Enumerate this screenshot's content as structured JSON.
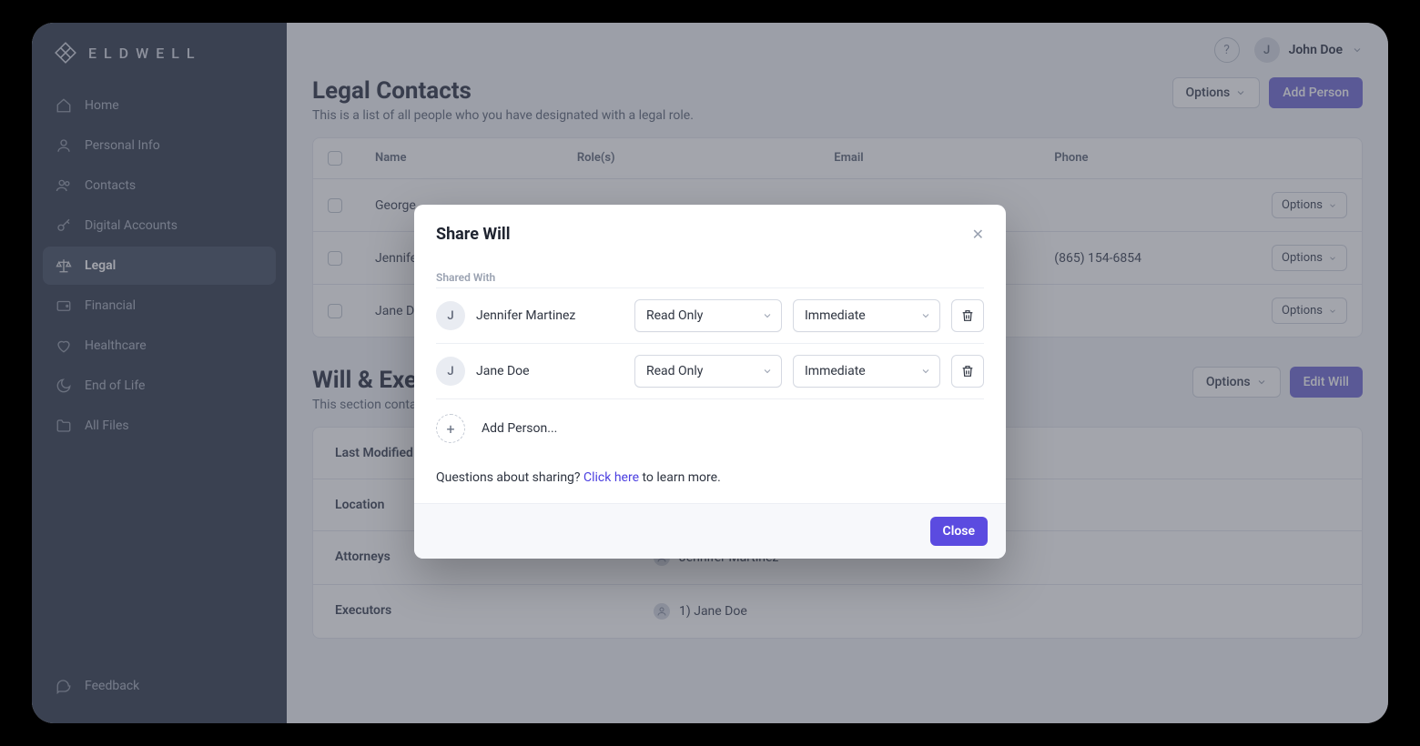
{
  "brand": "ELDWELL",
  "user": {
    "initial": "J",
    "name": "John Doe"
  },
  "nav": [
    {
      "label": "Home"
    },
    {
      "label": "Personal Info"
    },
    {
      "label": "Contacts"
    },
    {
      "label": "Digital Accounts"
    },
    {
      "label": "Legal",
      "active": true
    },
    {
      "label": "Financial"
    },
    {
      "label": "Healthcare"
    },
    {
      "label": "End of Life"
    },
    {
      "label": "All Files"
    }
  ],
  "feedback_label": "Feedback",
  "sections": {
    "contacts": {
      "title": "Legal Contacts",
      "subtitle": "This is a list of all people who you have designated with a legal role.",
      "options_label": "Options",
      "add_label": "Add Person",
      "columns": {
        "name": "Name",
        "roles": "Role(s)",
        "email": "Email",
        "phone": "Phone"
      },
      "rows": [
        {
          "name": "George",
          "roles": "",
          "email": "",
          "phone": "",
          "opt": "Options"
        },
        {
          "name": "Jennifer",
          "roles": "",
          "email": "",
          "phone": "(865) 154-6854",
          "opt": "Options"
        },
        {
          "name": "Jane Doe",
          "roles": "",
          "email": "",
          "phone": "",
          "opt": "Options"
        }
      ]
    },
    "will": {
      "title": "Will & Executors",
      "subtitle": "This section contains",
      "options_label": "Options",
      "edit_label": "Edit Will",
      "rows": [
        {
          "label": "Last Modified",
          "value": ""
        },
        {
          "label": "Location",
          "value": ""
        },
        {
          "label": "Attorneys",
          "value": "Jennifer Martinez"
        },
        {
          "label": "Executors",
          "value": "1) Jane Doe"
        }
      ]
    }
  },
  "modal": {
    "title": "Share Will",
    "shared_with_label": "Shared With",
    "people": [
      {
        "initial": "J",
        "name": "Jennifer Martinez",
        "access": "Read Only",
        "timing": "Immediate"
      },
      {
        "initial": "J",
        "name": "Jane Doe",
        "access": "Read Only",
        "timing": "Immediate"
      }
    ],
    "add_person_label": "Add Person...",
    "help_prefix": "Questions about sharing? ",
    "help_link": "Click here",
    "help_suffix": " to learn more.",
    "close_label": "Close"
  }
}
